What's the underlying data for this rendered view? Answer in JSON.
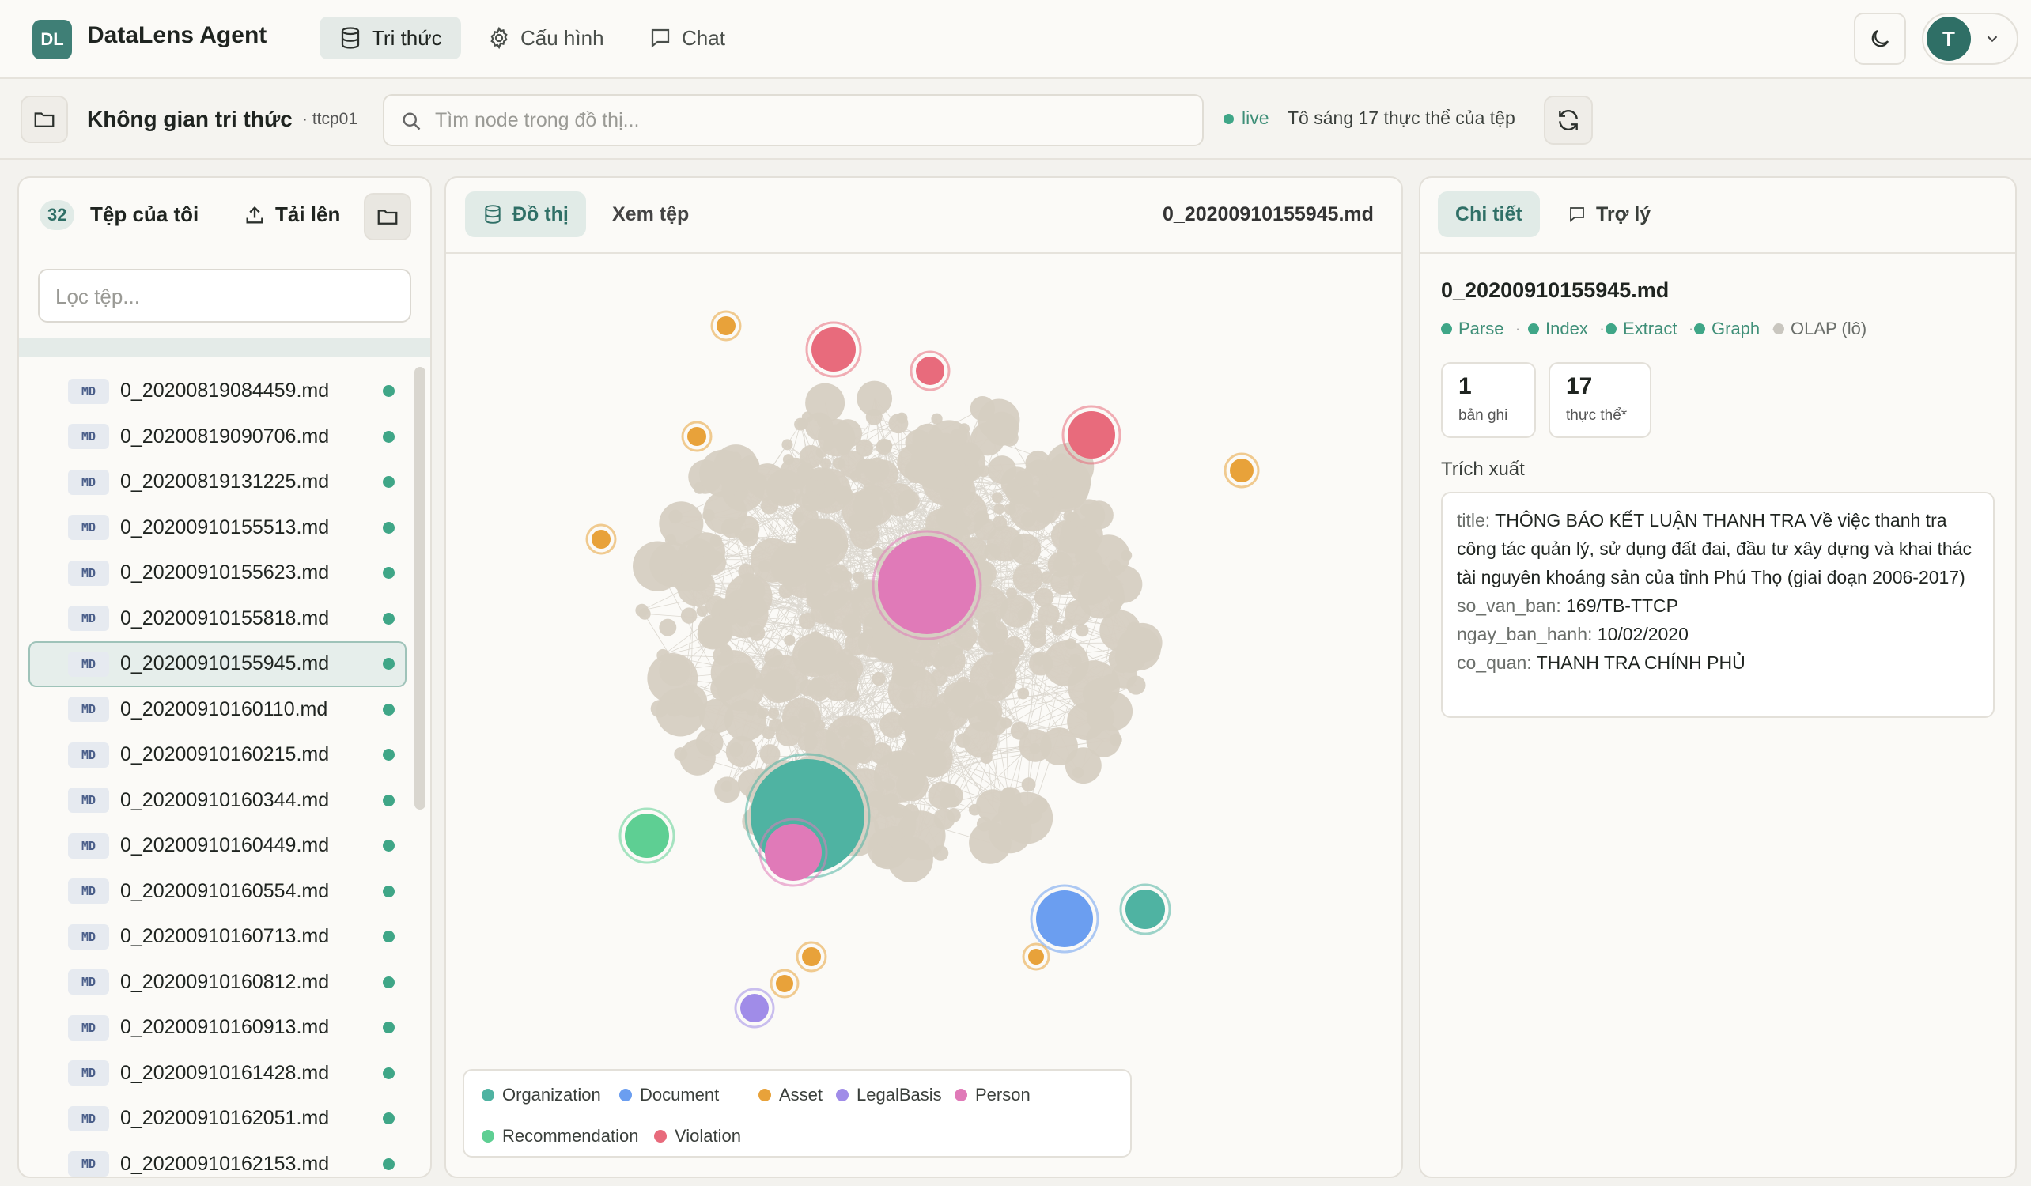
{
  "app": {
    "logo": "DL",
    "title": "DataLens Agent"
  },
  "nav": [
    {
      "label": "Tri thức",
      "icon": "database-icon",
      "active": true
    },
    {
      "label": "Cấu hình",
      "icon": "gear-icon",
      "active": false
    },
    {
      "label": "Chat",
      "icon": "chat-icon",
      "active": false
    }
  ],
  "user": {
    "initial": "T"
  },
  "subbar": {
    "title": "Không gian tri thức",
    "space_id": "· ttcp01",
    "search_placeholder": "Tìm node trong đồ thị...",
    "live": "live",
    "highlight": "Tô sáng 17 thực thể của tệp"
  },
  "files": {
    "count": "32",
    "title": "Tệp của tôi",
    "upload": "Tải lên",
    "filter_placeholder": "Lọc tệp...",
    "type_badge": "MD",
    "items": [
      "0_20200819084459.md",
      "0_20200819090706.md",
      "0_20200819131225.md",
      "0_20200910155513.md",
      "0_20200910155623.md",
      "0_20200910155818.md",
      "0_20200910155945.md",
      "0_20200910160110.md",
      "0_20200910160215.md",
      "0_20200910160344.md",
      "0_20200910160449.md",
      "0_20200910160554.md",
      "0_20200910160713.md",
      "0_20200910160812.md",
      "0_20200910160913.md",
      "0_20200910161428.md",
      "0_20200910162051.md",
      "0_20200910162153.md"
    ],
    "selected": "0_20200910155945.md"
  },
  "graph": {
    "tabs": [
      "Đồ thị",
      "Xem tệp"
    ],
    "file": "0_20200910155945.md",
    "legend": [
      {
        "label": "Organization",
        "color": "#4fb3a2"
      },
      {
        "label": "Document",
        "color": "#6b9ef0"
      },
      {
        "label": "Asset",
        "color": "#e8a23a"
      },
      {
        "label": "LegalBasis",
        "color": "#a08ce8"
      },
      {
        "label": "Person",
        "color": "#e07ab8"
      },
      {
        "label": "Recommendation",
        "color": "#5ecf93"
      },
      {
        "label": "Violation",
        "color": "#e86b7c"
      }
    ]
  },
  "detail": {
    "tabs": [
      "Chi tiết",
      "Trợ lý"
    ],
    "file": "0_20200910155945.md",
    "stages": [
      {
        "label": "Parse",
        "done": true
      },
      {
        "label": "Index",
        "done": true
      },
      {
        "label": "Extract",
        "done": true
      },
      {
        "label": "Graph",
        "done": true
      },
      {
        "label": "OLAP (lô)",
        "done": false
      }
    ],
    "stats": [
      {
        "value": "1",
        "label": "bản ghi"
      },
      {
        "value": "17",
        "label": "thực thể*"
      }
    ],
    "extract_label": "Trích xuất",
    "fields": {
      "title_key": "title:",
      "title": "THÔNG BÁO KẾT LUẬN THANH TRA Về việc thanh tra công tác quản lý, sử dụng đất đai, đầu tư xây dựng và khai thác tài nguyên khoáng sản của tỉnh Phú Thọ (giai đoạn 2006-2017)",
      "so_key": "so_van_ban:",
      "so": "169/TB-TTCP",
      "ngay_key": "ngay_ban_hanh:",
      "ngay": "10/02/2020",
      "co_key": "co_quan:",
      "co": "THANH TRA CHÍNH PHỦ"
    }
  },
  "colors": {
    "accent": "#2f6f66",
    "node_default": "#d6cfc2",
    "status_done": "#3fa687"
  }
}
